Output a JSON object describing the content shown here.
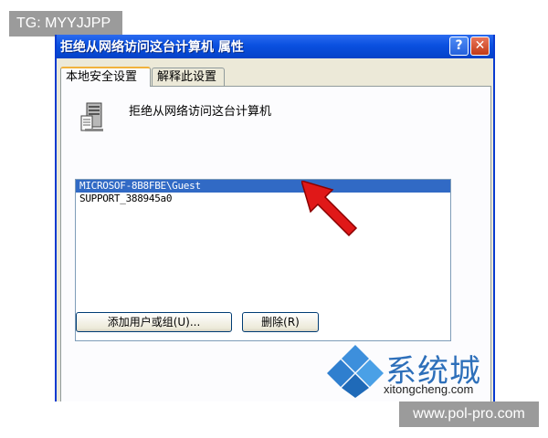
{
  "watermarks": {
    "top_left": "TG: MYYJJPP",
    "bottom_right": "www.pol-pro.com"
  },
  "window": {
    "title": "拒绝从网络访问这台计算机 属性",
    "help_button": "?",
    "close_button": "✕"
  },
  "tabs": [
    {
      "label": "本地安全设置",
      "active": true
    },
    {
      "label": "解释此设置",
      "active": false
    }
  ],
  "policy": {
    "icon": "policy-server-icon",
    "title": "拒绝从网络访问这台计算机"
  },
  "accounts": [
    {
      "name": "MICROSOF-8B8FBE\\Guest",
      "selected": true
    },
    {
      "name": "SUPPORT_388945a0",
      "selected": false
    }
  ],
  "buttons": {
    "add": "添加用户或组(U)...",
    "remove": "删除(R)"
  },
  "brand": {
    "name": "系统城",
    "url": "xitongcheng.com"
  },
  "colors": {
    "titlebar": "#0a50e0",
    "selection": "#316ac5",
    "arrow": "#e01818",
    "brand_blue": "#2d6fba"
  }
}
